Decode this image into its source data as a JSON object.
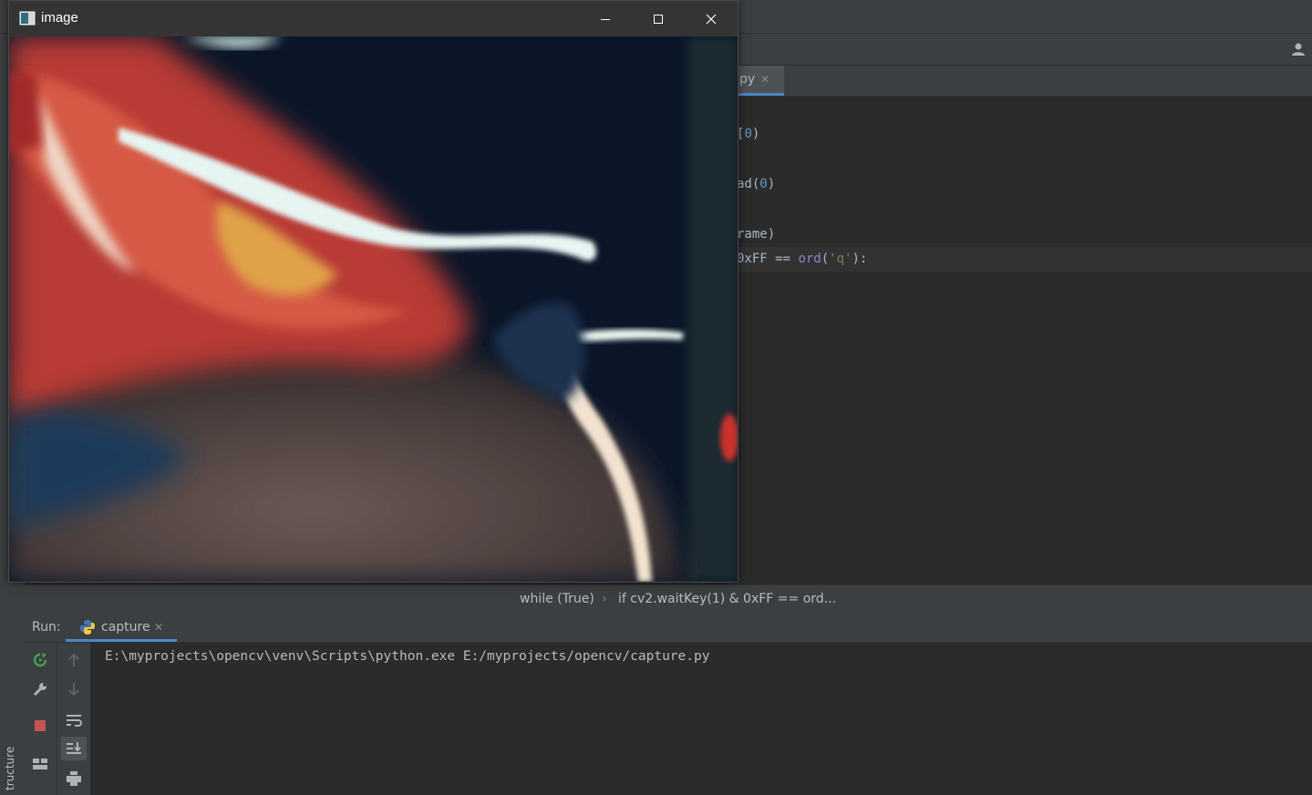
{
  "image_window": {
    "title": "image",
    "buttons": [
      "minimize",
      "maximize",
      "close"
    ]
  },
  "editor": {
    "tab_label": "py",
    "code_lines": [
      {
        "pre": "",
        "text": "[",
        "num": "0",
        "post": ")"
      },
      {
        "pre": "",
        "text": "ad(",
        "num": "0",
        "post": ")"
      },
      {
        "text": "rame)"
      },
      {
        "text": "0xFF == ord('q'):"
      }
    ],
    "line1": "[0)",
    "line2_a": "ad(",
    "line2_num": "0",
    "line2_b": ")",
    "line1_a": "[",
    "line1_num": "0",
    "line1_b": ")",
    "line3": "rame)",
    "line4_a": "0xFF == ",
    "line4_kw": "ord",
    "line4_b": "(",
    "line4_str": "'q'",
    "line4_c": "):"
  },
  "breadcrumb": {
    "item1": "while (True)",
    "separator": "›",
    "item2": "if cv2.waitKey(1) & 0xFF == ord..."
  },
  "run_panel": {
    "label": "Run:",
    "tab_label": "capture",
    "console_output": "E:\\myprojects\\opencv\\venv\\Scripts\\python.exe E:/myprojects/opencv/capture.py"
  },
  "sidebar": {
    "structure_label": "tructure"
  },
  "colors": {
    "accent": "#4a88c7",
    "stop_red": "#c75450",
    "rerun_green": "#499c54",
    "background": "#2b2b2b",
    "panel": "#3c3f41"
  }
}
